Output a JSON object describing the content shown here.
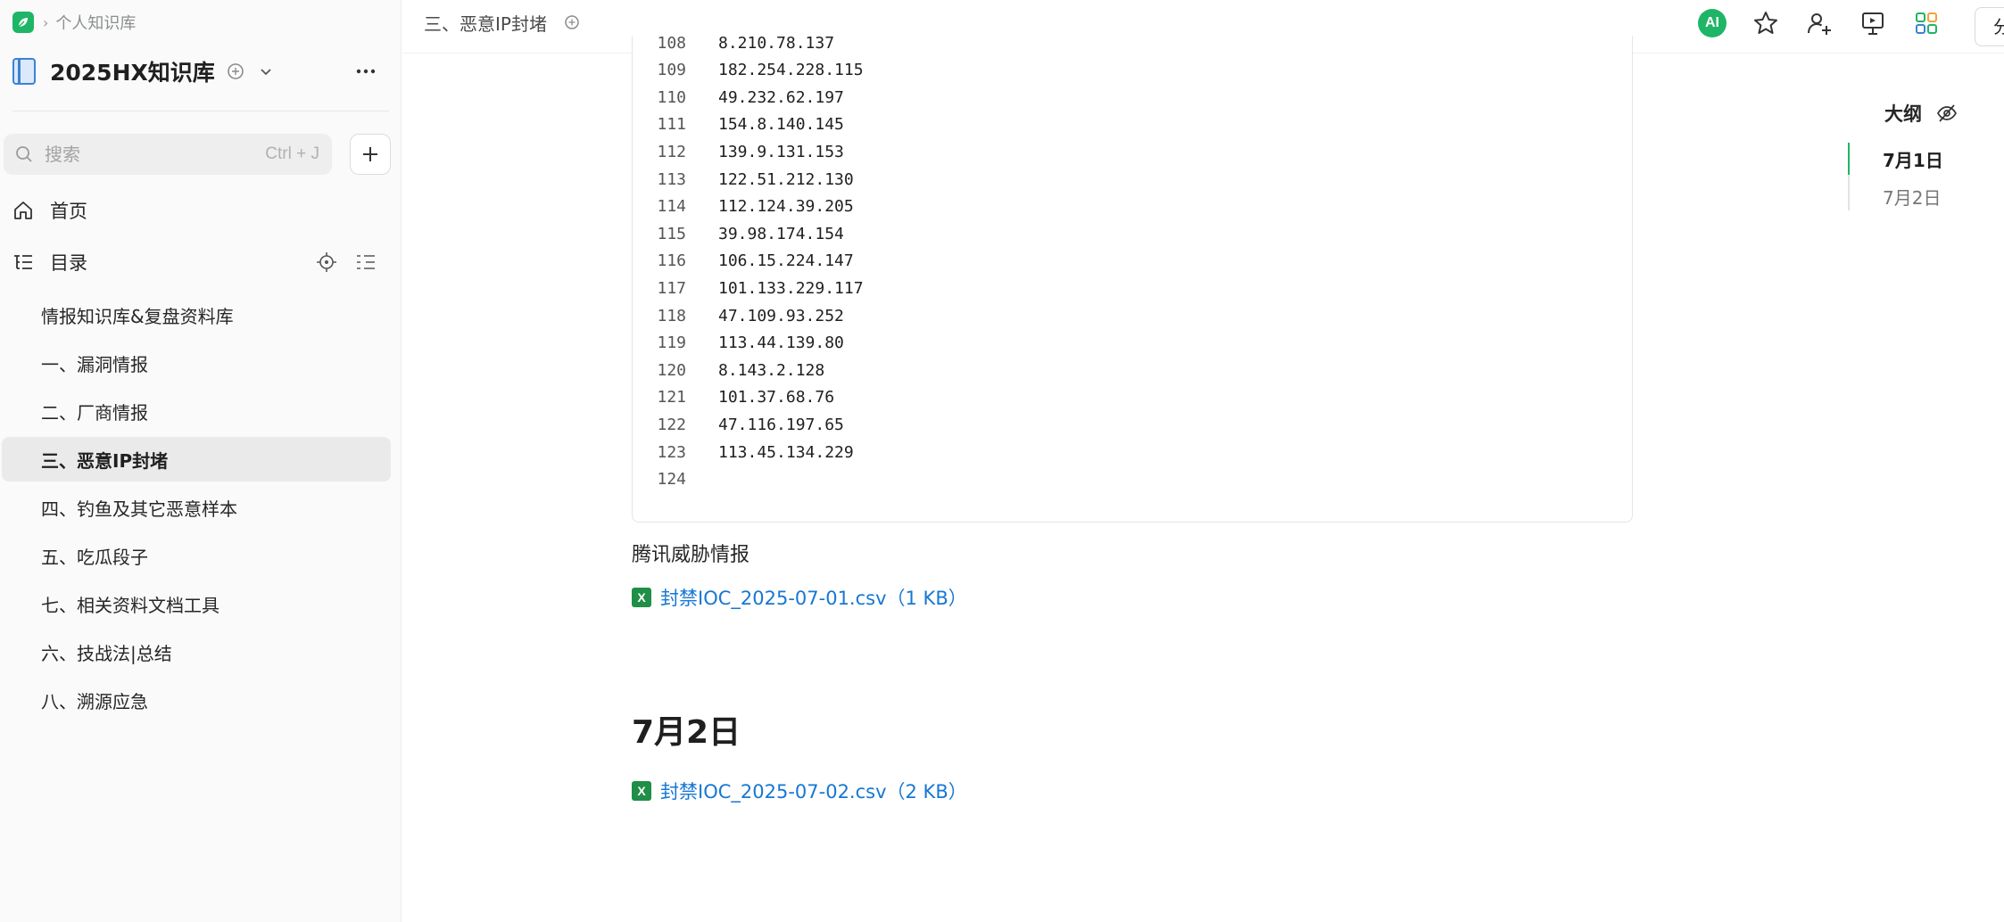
{
  "sidebar": {
    "breadcrumb": "个人知识库",
    "kb_title": "2025HX知识库",
    "search": {
      "placeholder": "搜索",
      "shortcut": "Ctrl + J"
    },
    "nav": {
      "home": "首页",
      "toc": "目录"
    },
    "toc_items": [
      "情报知识库&复盘资料库",
      "一、漏洞情报",
      "二、厂商情报",
      "三、恶意IP封堵",
      "四、钓鱼及其它恶意样本",
      "五、吃瓜段子",
      "七、相关资料文档工具",
      "六、技战法|总结",
      "八、溯源应急"
    ],
    "active_index": 3
  },
  "topbar": {
    "doc_title": "三、恶意IP封堵",
    "ai_label": "AI",
    "share_label": "分"
  },
  "content": {
    "code_lines": [
      {
        "num": "108",
        "text": "8.210.78.137"
      },
      {
        "num": "109",
        "text": "182.254.228.115"
      },
      {
        "num": "110",
        "text": "49.232.62.197"
      },
      {
        "num": "111",
        "text": "154.8.140.145"
      },
      {
        "num": "112",
        "text": "139.9.131.153"
      },
      {
        "num": "113",
        "text": "122.51.212.130"
      },
      {
        "num": "114",
        "text": "112.124.39.205"
      },
      {
        "num": "115",
        "text": "39.98.174.154"
      },
      {
        "num": "116",
        "text": "106.15.224.147"
      },
      {
        "num": "117",
        "text": "101.133.229.117"
      },
      {
        "num": "118",
        "text": "47.109.93.252"
      },
      {
        "num": "119",
        "text": "113.44.139.80"
      },
      {
        "num": "120",
        "text": "8.143.2.128"
      },
      {
        "num": "121",
        "text": "101.37.68.76"
      },
      {
        "num": "122",
        "text": "47.116.197.65"
      },
      {
        "num": "123",
        "text": "113.45.134.229"
      },
      {
        "num": "124",
        "text": ""
      }
    ],
    "paragraph": "腾讯威胁情报",
    "file1": "封禁IOC_2025-07-01.csv（1 KB）",
    "heading_july2": "7月2日",
    "file2": "封禁IOC_2025-07-02.csv（2 KB）",
    "file_icon_glyph": "X"
  },
  "outline": {
    "title": "大纲",
    "items": [
      "7月1日",
      "7月2日"
    ],
    "active_index": 0
  },
  "colors": {
    "accent": "#1fb566",
    "link": "#1677d4",
    "excel": "#1f8e47"
  }
}
